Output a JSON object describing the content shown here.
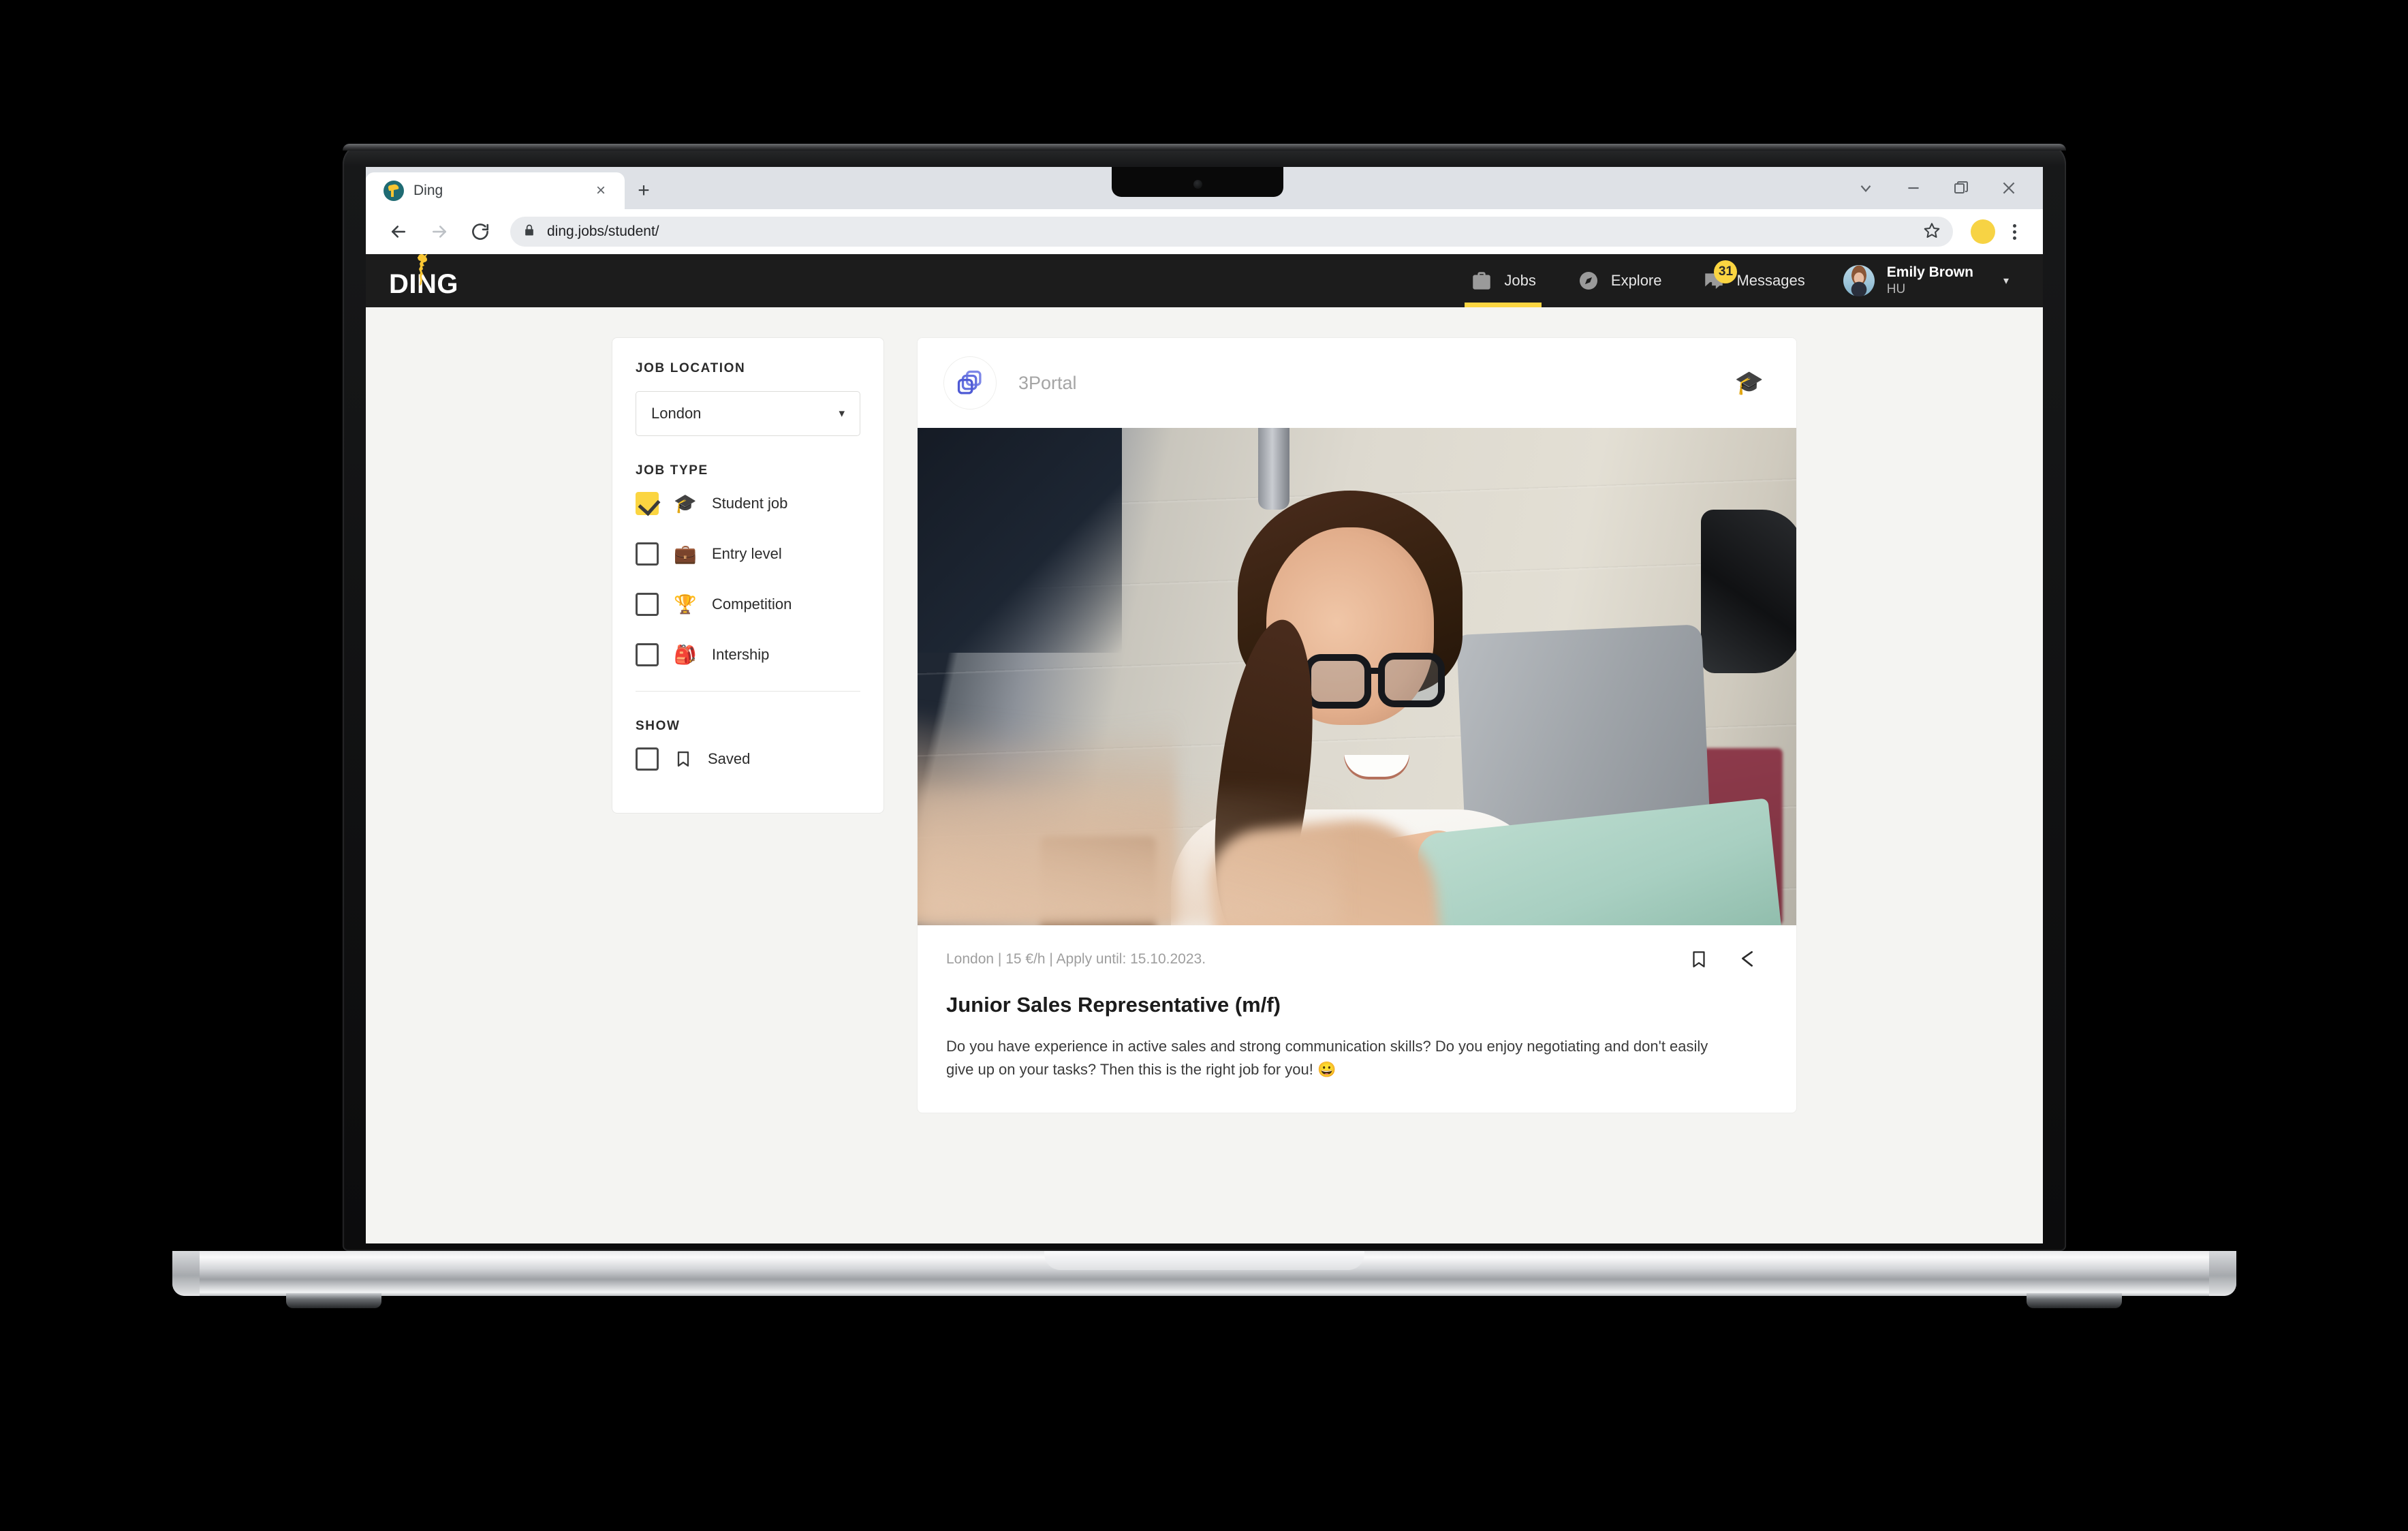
{
  "browser": {
    "tab": {
      "title": "Ding",
      "favicon": "ding-giraffe-favicon",
      "close_label": "×"
    },
    "new_tab_label": "+",
    "window_controls": {
      "collapse": "⌄",
      "minimize": "–",
      "maximize": "❐",
      "close": "✕"
    },
    "toolbar": {
      "back": "←",
      "forward": "→",
      "reload": "↻",
      "lock_icon": "lock-icon",
      "url": "ding.jobs/student/",
      "bookmark_star": "☆",
      "profile_color": "#f7d344",
      "menu": "chrome-menu-icon"
    }
  },
  "app": {
    "brand": {
      "text": "DING",
      "mark": "giraffe-logo"
    },
    "nav": [
      {
        "label": "Jobs",
        "icon": "briefcase-icon",
        "active": true,
        "badge": ""
      },
      {
        "label": "Explore",
        "icon": "compass-icon",
        "active": false,
        "badge": ""
      },
      {
        "label": "Messages",
        "icon": "chat-icon",
        "active": false,
        "badge": "31"
      }
    ],
    "user": {
      "name": "Emily Brown",
      "subtitle": "HU",
      "caret": "▾"
    },
    "accent_color": "#fbd541",
    "nav_bg": "#1c1c1c",
    "page_bg": "#f4f4f2"
  },
  "filters": {
    "location": {
      "title": "JOB LOCATION",
      "value": "London",
      "caret": "▾"
    },
    "job_type": {
      "title": "JOB TYPE",
      "options": [
        {
          "label": "Student job",
          "emoji": "🎓",
          "checked": true
        },
        {
          "label": "Entry level",
          "emoji": "💼",
          "checked": false
        },
        {
          "label": "Competition",
          "emoji": "🏆",
          "checked": false
        },
        {
          "label": "Intership",
          "emoji": "🎒",
          "checked": false
        }
      ]
    },
    "show": {
      "title": "SHOW",
      "options": [
        {
          "label": "Saved",
          "icon": "bookmark-icon",
          "checked": false
        }
      ]
    }
  },
  "job_card": {
    "company": "3Portal",
    "company_logo": "layered-squares-logo",
    "type_badge": "🎓",
    "photo_alt": "Smiling young woman with glasses working on a laptop in a studio",
    "meta": "London  |  15 €/h  |  Apply until: 15.10.2023.",
    "location": "London",
    "pay": "15 €/h",
    "deadline": "Apply until: 15.10.2023.",
    "actions": {
      "save": "bookmark-icon",
      "share": "share-icon"
    },
    "title": "Junior Sales Representative (m/f)",
    "description": "Do you have experience in active sales and strong communication skills? Do you enjoy negotiating and don't easily give up on your tasks? Then this is the right job for you! 😀"
  }
}
